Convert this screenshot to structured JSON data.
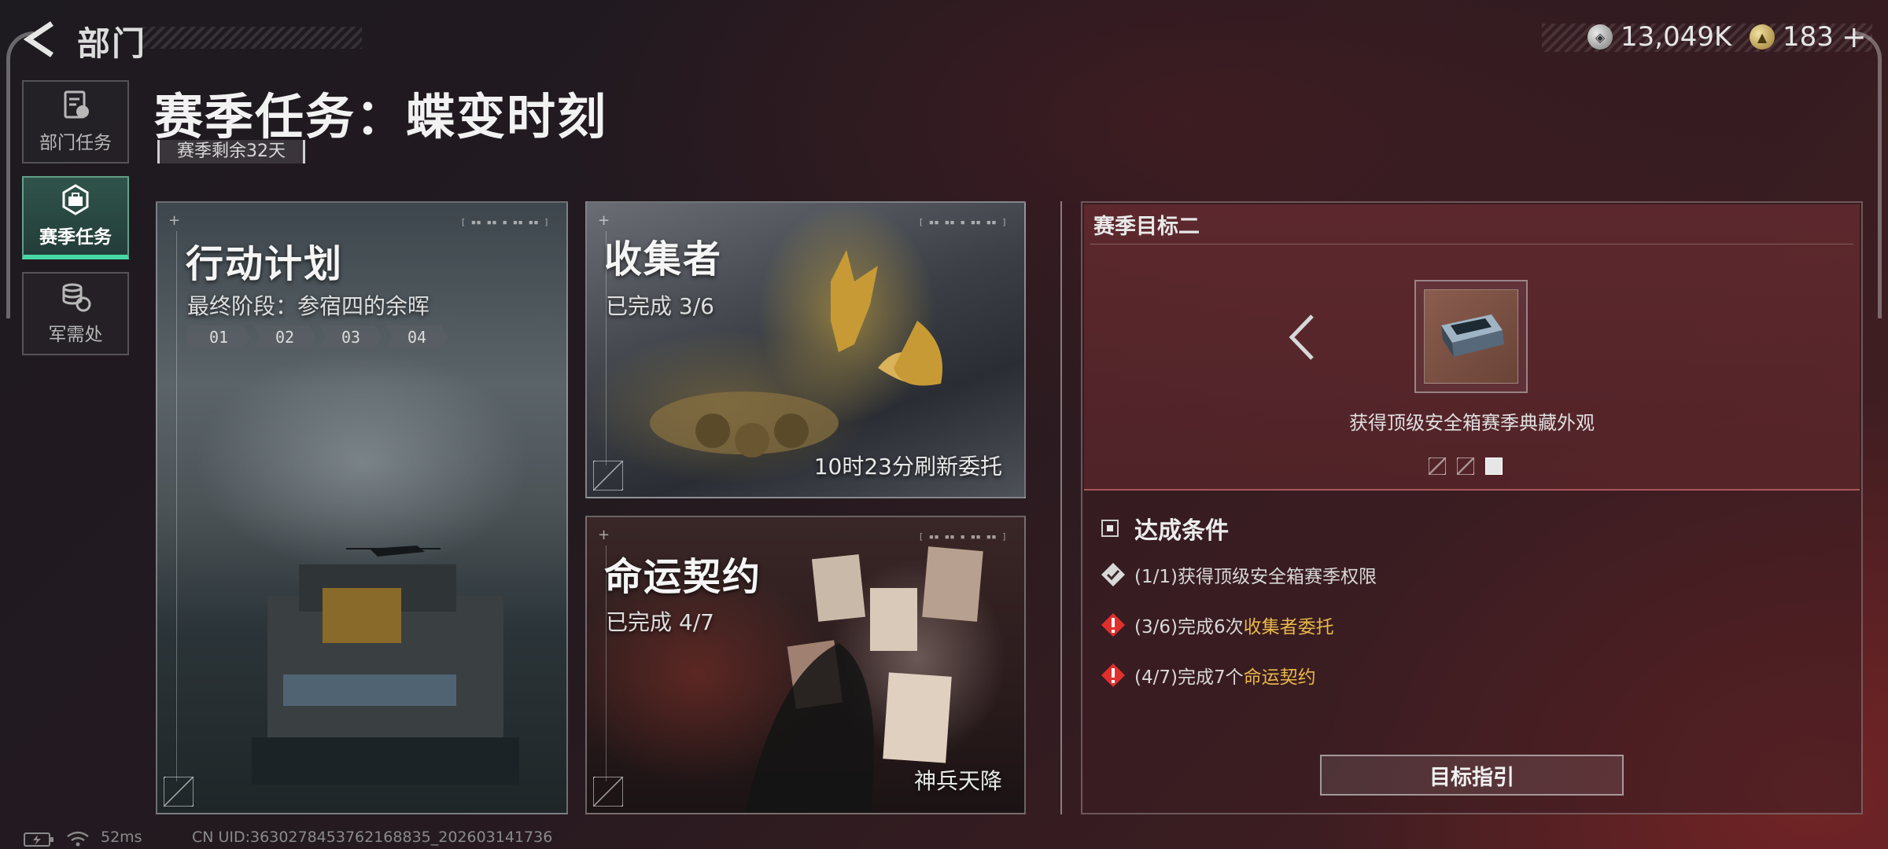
{
  "header": {
    "back_label": "部门",
    "currency": [
      {
        "icon": "silver-coin-icon",
        "value": "13,049K"
      },
      {
        "icon": "gold-coin-icon",
        "value": "183"
      }
    ],
    "add_label": "+"
  },
  "sidebar": {
    "items": [
      {
        "label": "部门任务",
        "icon": "dept-task-icon",
        "active": false
      },
      {
        "label": "赛季任务",
        "icon": "season-task-icon",
        "active": true
      },
      {
        "label": "军需处",
        "icon": "supply-icon",
        "active": false
      }
    ]
  },
  "main": {
    "title": "赛季任务：蝶变时刻",
    "season_remaining": "赛季剩余32天"
  },
  "cards": {
    "action": {
      "title": "行动计划",
      "subtitle": "最终阶段：参宿四的余晖",
      "stages": [
        "01",
        "02",
        "03",
        "04"
      ]
    },
    "collector": {
      "title": "收集者",
      "progress": "已完成 3/6",
      "footer": "10时23分刷新委托"
    },
    "fate": {
      "title": "命运契约",
      "progress": "已完成 4/7",
      "footer": "神兵天降"
    }
  },
  "goal_panel": {
    "title": "赛季目标二",
    "reward_text": "获得顶级安全箱赛季典藏外观",
    "pager_total": 3,
    "pager_active": 3,
    "conditions_title": "达成条件",
    "conditions": [
      {
        "status": "done",
        "prefix": "(1/1)获得顶级安全箱赛季权限",
        "highlight": ""
      },
      {
        "status": "pending",
        "prefix": "(3/6)完成6次",
        "highlight": "收集者委托"
      },
      {
        "status": "pending",
        "prefix": "(4/7)完成7个",
        "highlight": "命运契约"
      }
    ],
    "guide_button": "目标指引"
  },
  "status_bar": {
    "ping": "52ms",
    "uid": "CN UID:3630278453762168835_202603141736"
  },
  "colors": {
    "accent_green": "#46d8a6",
    "highlight_gold": "#e8b84a",
    "alert_red": "#e0302e"
  }
}
